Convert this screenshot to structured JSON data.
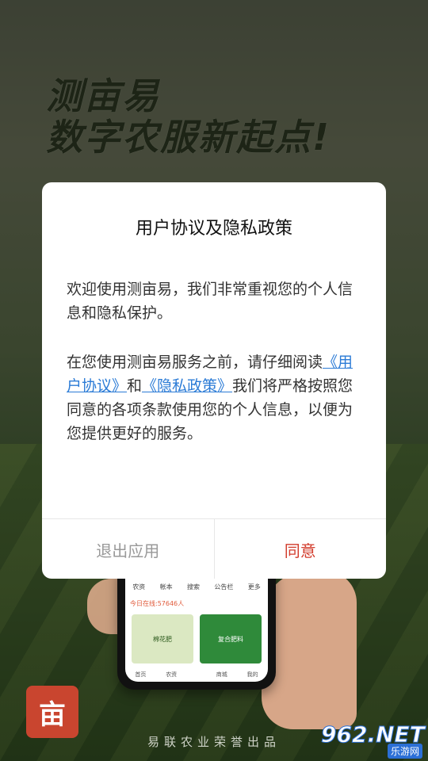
{
  "headline": {
    "line1": "测亩易",
    "line2": "数字农服新起点!"
  },
  "dialog": {
    "title": "用户协议及隐私政策",
    "para1": "欢迎使用测亩易，我们非常重视您的个人信息和隐私保护。",
    "para2_prefix": "在您使用测亩易服务之前，请仔细阅读",
    "link_terms": "《用户协议》",
    "and_text": "和",
    "link_privacy": "《隐私政策》",
    "para2_suffix": "我们将严格按照您同意的各项条款使用您的个人信息，以便为您提供更好的服务。",
    "exit_label": "退出应用",
    "agree_label": "同意"
  },
  "phone": {
    "nav": [
      "农资",
      "帐本",
      "搜索",
      "公告栏",
      "更多"
    ],
    "notice": "今日在线:57646人",
    "product_a": "棉花肥",
    "product_b": "复合肥料",
    "tabs": [
      "首页",
      "农资",
      "",
      "商城",
      "我的"
    ]
  },
  "logo_char": "亩",
  "footer": "易联农业荣誉出品",
  "watermark": {
    "num": "962.NET",
    "text": "乐游网"
  }
}
